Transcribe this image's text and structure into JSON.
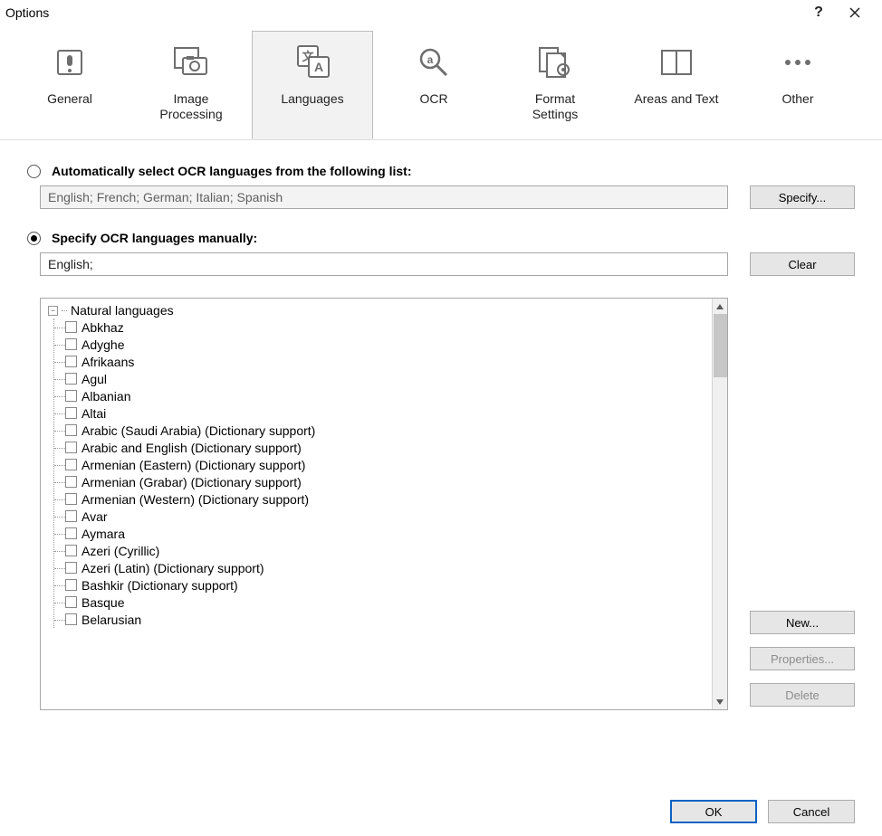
{
  "window": {
    "title": "Options",
    "help_tooltip": "?",
    "close_tooltip": "×"
  },
  "tabs": [
    {
      "id": "general",
      "label": "General",
      "active": false
    },
    {
      "id": "image-processing",
      "label": "Image\nProcessing",
      "active": false
    },
    {
      "id": "languages",
      "label": "Languages",
      "active": true
    },
    {
      "id": "ocr",
      "label": "OCR",
      "active": false
    },
    {
      "id": "format-settings",
      "label": "Format\nSettings",
      "active": false
    },
    {
      "id": "areas-and-text",
      "label": "Areas and Text",
      "active": false
    },
    {
      "id": "other",
      "label": "Other",
      "active": false
    }
  ],
  "auto_section": {
    "radio_selected": false,
    "label": "Automatically select OCR languages from the following list:",
    "value": "English; French; German; Italian; Spanish",
    "specify_btn": "Specify..."
  },
  "manual_section": {
    "radio_selected": true,
    "label": "Specify OCR languages manually:",
    "value": "English;",
    "clear_btn": "Clear"
  },
  "tree": {
    "root_label": "Natural languages",
    "items": [
      "Abkhaz",
      "Adyghe",
      "Afrikaans",
      "Agul",
      "Albanian",
      "Altai",
      "Arabic (Saudi Arabia) (Dictionary support)",
      "Arabic and English (Dictionary support)",
      "Armenian (Eastern) (Dictionary support)",
      "Armenian (Grabar) (Dictionary support)",
      "Armenian (Western) (Dictionary support)",
      "Avar",
      "Aymara",
      "Azeri (Cyrillic)",
      "Azeri (Latin) (Dictionary support)",
      "Bashkir (Dictionary support)",
      "Basque",
      "Belarusian"
    ]
  },
  "side_buttons": {
    "new": "New...",
    "properties": "Properties...",
    "delete": "Delete"
  },
  "footer": {
    "ok": "OK",
    "cancel": "Cancel"
  }
}
